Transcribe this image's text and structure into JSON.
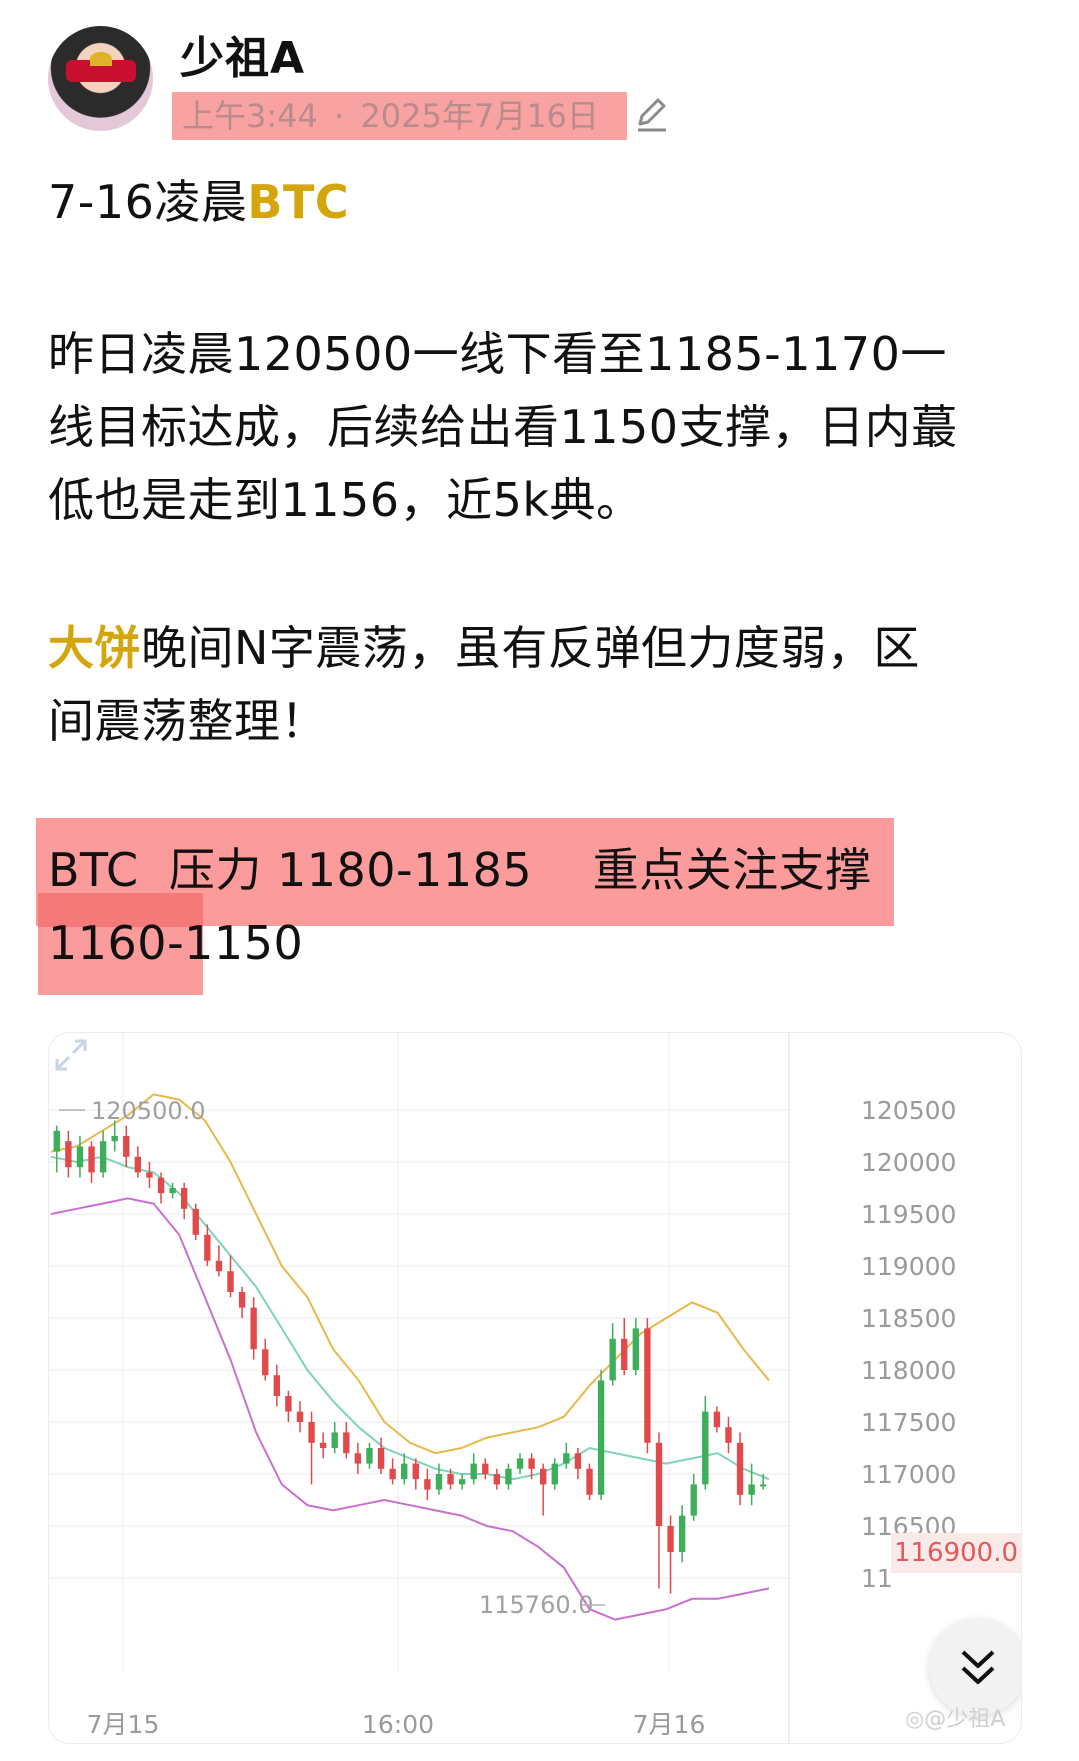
{
  "post": {
    "author": "少祖A",
    "time": "上午3:44",
    "date_sep": "·",
    "date": "2025年7月16日",
    "title_prefix": "7-16凌晨",
    "title_highlight": "BTC",
    "para1": [
      "昨日凌晨120500一线下看至1185-1170一",
      "线目标达成，后续给出看1150支撑，日内蕞",
      "低也是走到1156，近5k典。"
    ],
    "para2_highlight": "大饼",
    "para2_line1_rest": "晚间N字震荡，虽有反弹但力度弱，区",
    "para2_line2": "间震荡整理！",
    "para3_line1": "BTC  压力 1180-1185    重点关注支撑",
    "para3_line2": "1160-1150"
  },
  "chart_data": {
    "type": "candlestick",
    "y_ticks": [
      "120500",
      "120000",
      "119500",
      "119000",
      "118500",
      "118000",
      "117500",
      "117000",
      "116500",
      "11"
    ],
    "x_ticks": [
      "7月15",
      "16:00",
      "7月16"
    ],
    "high_label": "120500.0",
    "low_label": "115760.0",
    "current_price": "116900.0",
    "ylim": [
      115400,
      121000
    ],
    "candles": [
      [
        120100,
        120300,
        119900,
        120350
      ],
      [
        120200,
        119950,
        119850,
        120300
      ],
      [
        119950,
        120150,
        119850,
        120250
      ],
      [
        120150,
        119900,
        119800,
        120200
      ],
      [
        119900,
        120200,
        119850,
        120300
      ],
      [
        120200,
        120250,
        120100,
        120400
      ],
      [
        120250,
        120050,
        119950,
        120350
      ],
      [
        120050,
        119900,
        119850,
        120150
      ],
      [
        119900,
        119850,
        119750,
        120000
      ],
      [
        119850,
        119700,
        119600,
        119900
      ],
      [
        119700,
        119750,
        119650,
        119800
      ],
      [
        119750,
        119550,
        119450,
        119800
      ],
      [
        119550,
        119300,
        119250,
        119600
      ],
      [
        119300,
        119050,
        119000,
        119400
      ],
      [
        119050,
        118950,
        118900,
        119200
      ],
      [
        118950,
        118750,
        118700,
        119100
      ],
      [
        118750,
        118600,
        118500,
        118800
      ],
      [
        118600,
        118200,
        118100,
        118700
      ],
      [
        118200,
        117950,
        117900,
        118300
      ],
      [
        117950,
        117750,
        117650,
        118050
      ],
      [
        117750,
        117600,
        117500,
        117800
      ],
      [
        117600,
        117500,
        117400,
        117700
      ],
      [
        117500,
        117300,
        116900,
        117600
      ],
      [
        117300,
        117250,
        117150,
        117400
      ],
      [
        117250,
        117400,
        117200,
        117500
      ],
      [
        117400,
        117200,
        117150,
        117500
      ],
      [
        117200,
        117100,
        117000,
        117300
      ],
      [
        117100,
        117250,
        117050,
        117300
      ],
      [
        117250,
        117050,
        117000,
        117350
      ],
      [
        117050,
        116950,
        116900,
        117150
      ],
      [
        116950,
        117100,
        116900,
        117200
      ],
      [
        117100,
        116950,
        116850,
        117150
      ],
      [
        116950,
        116850,
        116750,
        117050
      ],
      [
        116850,
        117000,
        116800,
        117100
      ],
      [
        117000,
        116900,
        116850,
        117050
      ],
      [
        116900,
        116950,
        116850,
        117000
      ],
      [
        116950,
        117100,
        116900,
        117200
      ],
      [
        117100,
        117000,
        116950,
        117150
      ],
      [
        117000,
        116900,
        116850,
        117050
      ],
      [
        116900,
        117050,
        116850,
        117100
      ],
      [
        117050,
        117150,
        117000,
        117200
      ],
      [
        117150,
        117050,
        116950,
        117200
      ],
      [
        117050,
        116900,
        116600,
        117100
      ],
      [
        116900,
        117100,
        116850,
        117150
      ],
      [
        117100,
        117200,
        117050,
        117300
      ],
      [
        117200,
        117050,
        116950,
        117250
      ],
      [
        117050,
        116800,
        116750,
        117100
      ],
      [
        116800,
        117900,
        116750,
        118000
      ],
      [
        117900,
        118300,
        117850,
        118450
      ],
      [
        118300,
        118000,
        117950,
        118500
      ],
      [
        118000,
        118400,
        117950,
        118500
      ],
      [
        118400,
        117300,
        117200,
        118500
      ],
      [
        117300,
        116500,
        115900,
        117400
      ],
      [
        116500,
        116250,
        115850,
        116600
      ],
      [
        116250,
        116600,
        116150,
        116700
      ],
      [
        116600,
        116900,
        116550,
        117000
      ],
      [
        116900,
        117600,
        116850,
        117750
      ],
      [
        117600,
        117450,
        117400,
        117650
      ],
      [
        117450,
        117300,
        117200,
        117550
      ],
      [
        117300,
        116800,
        116700,
        117400
      ],
      [
        116800,
        116900,
        116700,
        117100
      ],
      [
        116900,
        116900,
        116850,
        117000
      ]
    ],
    "upper_band": [
      120100,
      120150,
      120300,
      120450,
      120650,
      120600,
      120400,
      120000,
      119500,
      119000,
      118700,
      118200,
      117900,
      117500,
      117300,
      117200,
      117250,
      117350,
      117400,
      117450,
      117550,
      117850,
      118100,
      118350,
      118500,
      118650,
      118550,
      118200,
      117900
    ],
    "middle_band": [
      120050,
      120000,
      120050,
      119950,
      119900,
      119700,
      119400,
      119100,
      118800,
      118400,
      118000,
      117700,
      117450,
      117250,
      117150,
      117050,
      117000,
      117000,
      116950,
      117000,
      117100,
      117250,
      117200,
      117150,
      117100,
      117150,
      117200,
      117050,
      116950
    ],
    "lower_band": [
      119500,
      119550,
      119600,
      119650,
      119600,
      119300,
      118700,
      118100,
      117400,
      116900,
      116700,
      116650,
      116700,
      116750,
      116700,
      116650,
      116600,
      116500,
      116450,
      116300,
      116100,
      115700,
      115600,
      115650,
      115700,
      115800,
      115800,
      115850,
      115900
    ]
  }
}
